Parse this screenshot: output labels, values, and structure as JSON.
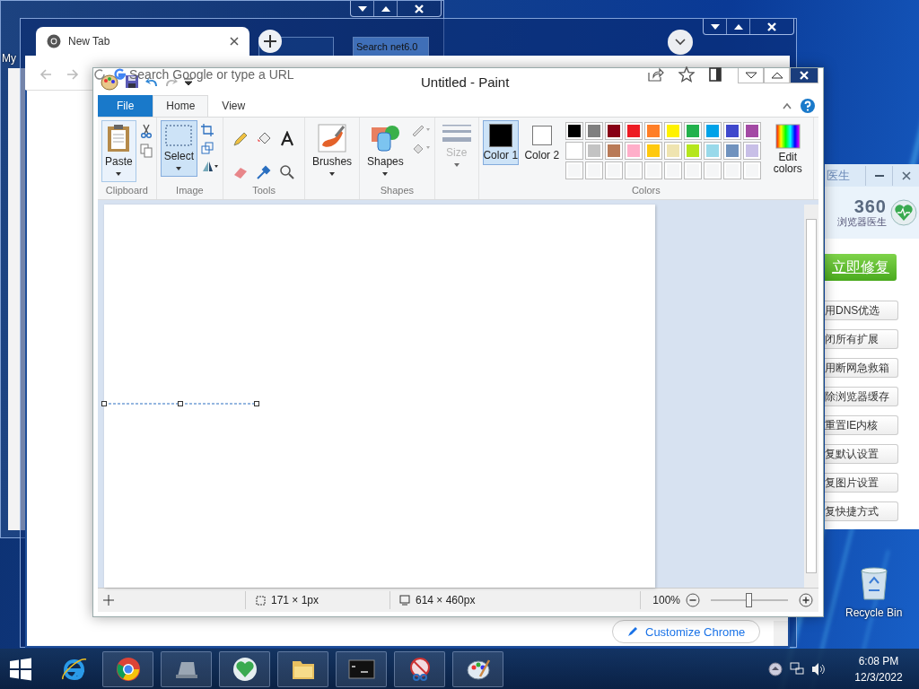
{
  "desktop": {
    "icon_label": "My",
    "recycle_bin": "Recycle Bin"
  },
  "back_window": {
    "search_box": "Search net6.0"
  },
  "chrome": {
    "tab_title": "New Tab",
    "omnibox_placeholder": "Search Google or type a URL",
    "customize_button": "Customize Chrome"
  },
  "paint": {
    "title": "Untitled - Paint",
    "tabs": [
      {
        "label": "File",
        "kind": "file",
        "selected": false
      },
      {
        "label": "Home",
        "kind": "tab",
        "selected": true
      },
      {
        "label": "View",
        "kind": "tab",
        "selected": false
      }
    ],
    "clipboard": {
      "label": "Clipboard",
      "paste": "Paste"
    },
    "image": {
      "label": "Image",
      "select": "Select",
      "select_pressed": true
    },
    "tools": {
      "label": "Tools"
    },
    "brushes": "Brushes",
    "shapes": {
      "label": "Shapes",
      "button": "Shapes"
    },
    "size": {
      "label": "Size",
      "disabled": true
    },
    "colors": {
      "label": "Colors",
      "edit": "Edit colors",
      "slots": [
        {
          "label": "Color 1",
          "color": "#000000",
          "selected": true
        },
        {
          "label": "Color 2",
          "color": "#ffffff",
          "selected": false
        }
      ],
      "palette": [
        {
          "kind": "swatch",
          "color": "#000000"
        },
        {
          "kind": "swatch",
          "color": "#7f7f7f"
        },
        {
          "kind": "swatch",
          "color": "#880015"
        },
        {
          "kind": "swatch",
          "color": "#ed1c24"
        },
        {
          "kind": "swatch",
          "color": "#ff7f27"
        },
        {
          "kind": "swatch",
          "color": "#fff200"
        },
        {
          "kind": "swatch",
          "color": "#22b14c"
        },
        {
          "kind": "swatch",
          "color": "#00a2e8"
        },
        {
          "kind": "swatch",
          "color": "#3f48cc"
        },
        {
          "kind": "swatch",
          "color": "#a349a4"
        },
        {
          "kind": "swatch",
          "color": "#ffffff"
        },
        {
          "kind": "swatch",
          "color": "#c3c3c3"
        },
        {
          "kind": "swatch",
          "color": "#b97a57"
        },
        {
          "kind": "swatch",
          "color": "#ffaec9"
        },
        {
          "kind": "swatch",
          "color": "#ffc90e"
        },
        {
          "kind": "swatch",
          "color": "#efe4b0"
        },
        {
          "kind": "swatch",
          "color": "#b5e61d"
        },
        {
          "kind": "swatch",
          "color": "#99d9ea"
        },
        {
          "kind": "swatch",
          "color": "#7092be"
        },
        {
          "kind": "swatch",
          "color": "#c8bfe7"
        },
        {
          "kind": "empty"
        },
        {
          "kind": "empty"
        },
        {
          "kind": "empty"
        },
        {
          "kind": "empty"
        },
        {
          "kind": "empty"
        },
        {
          "kind": "empty"
        },
        {
          "kind": "empty"
        },
        {
          "kind": "empty"
        },
        {
          "kind": "empty"
        },
        {
          "kind": "empty"
        }
      ]
    },
    "status": {
      "selection_size": "171 × 1px",
      "canvas_size": "614 × 460px",
      "zoom": "100%",
      "zoom_slider": {
        "level": 0.5
      }
    }
  },
  "doctor360": {
    "title": "医生",
    "logo": "360",
    "subtitle": "浏览器医生",
    "fix_button": "立即修复",
    "actions": [
      "用DNS优选",
      "闭所有扩展",
      "用断网急救箱",
      "除浏览器缓存",
      "重置IE内核",
      "复默认设置",
      "复图片设置",
      "复快捷方式"
    ]
  },
  "taskbar": {
    "time": "6:08 PM",
    "date": "12/3/2022"
  }
}
